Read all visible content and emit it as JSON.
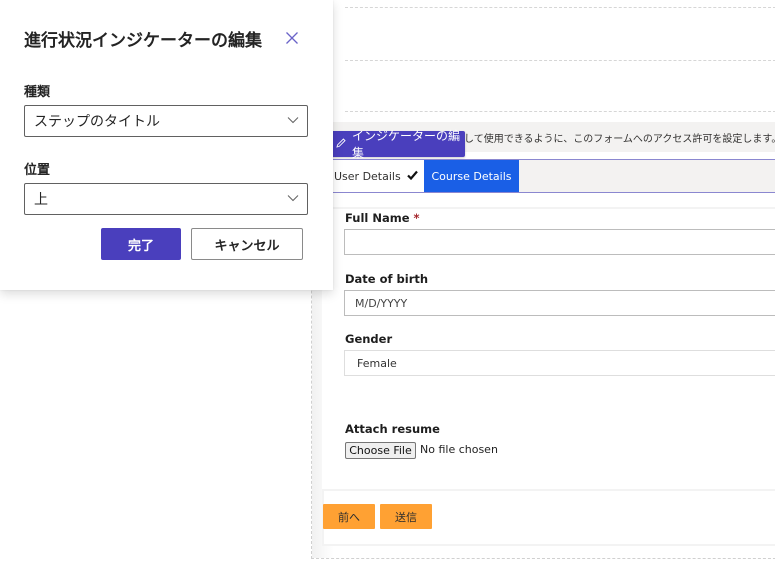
{
  "popover": {
    "title": "進行状況インジケーターの編集",
    "close_icon": "close-icon",
    "type_label": "種類",
    "type_value": "ステップのタイトル",
    "position_label": "位置",
    "position_value": "上",
    "done_label": "完了",
    "cancel_label": "キャンセル"
  },
  "editor": {
    "notice_text": "して使用できるように、このフォームへのアクセス許可を設定します。",
    "edit_indicator_label": "インジケーターの編集",
    "edit_indicator_icon": "pencil-icon",
    "tabs": [
      {
        "label": "User Details",
        "completed": true,
        "active": false
      },
      {
        "label": "Course Details",
        "completed": false,
        "active": true
      }
    ],
    "check_icon": "checkmark-icon"
  },
  "form": {
    "fields": [
      {
        "label": "Full Name",
        "required": true,
        "value": "",
        "placeholder": ""
      },
      {
        "label": "Date of birth",
        "required": false,
        "value": "",
        "placeholder": "M/D/YYYY"
      },
      {
        "label": "Gender",
        "required": false,
        "value": "Female"
      }
    ],
    "required_marker": "*",
    "attach": {
      "label": "Attach resume",
      "button_label": "Choose File",
      "status": "No file chosen"
    },
    "prev_label": "前へ",
    "submit_label": "送信"
  },
  "colors": {
    "accent": "#4a3fbd",
    "tab_active": "#1a5fe6",
    "action_orange": "#ffa133"
  }
}
